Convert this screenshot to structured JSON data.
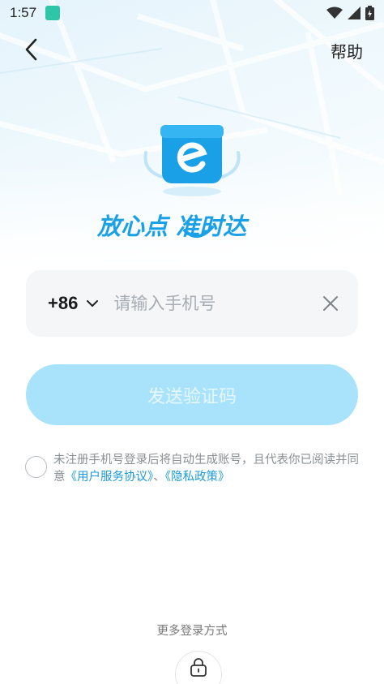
{
  "status_bar": {
    "time": "1:57"
  },
  "header": {
    "help_label": "帮助"
  },
  "brand": {
    "slogan": "放心点 准时达",
    "accent": "#1aa0e6"
  },
  "phone": {
    "country_code": "+86",
    "placeholder": "请输入手机号",
    "value": ""
  },
  "send_button": {
    "label": "发送验证码"
  },
  "agreement": {
    "text_before": "未注册手机号登录后将自动生成账号，且代表你已阅读并同意",
    "user_agreement": "《用户服务协议》",
    "separator": "、",
    "privacy_policy": "《隐私政策》"
  },
  "more_login": {
    "label": "更多登录方式",
    "icon": "lock-icon"
  }
}
